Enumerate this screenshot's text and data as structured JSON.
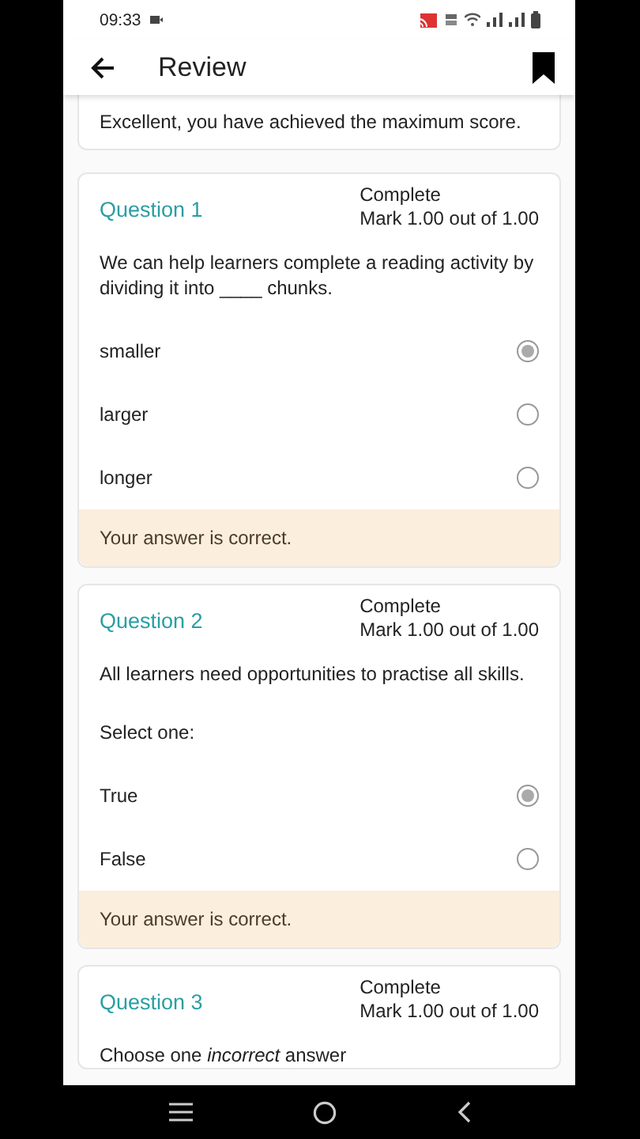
{
  "status_bar": {
    "time": "09:33"
  },
  "app_bar": {
    "title": "Review"
  },
  "feedback": {
    "text": "Excellent, you have achieved the maximum score."
  },
  "questions": [
    {
      "title": "Question 1",
      "state": "Complete",
      "mark": "Mark 1.00 out of 1.00",
      "text": "We can help learners complete a reading activity by dividing it into ____ chunks.",
      "options": [
        {
          "label": "smaller",
          "selected": true
        },
        {
          "label": "larger",
          "selected": false
        },
        {
          "label": "longer",
          "selected": false
        }
      ],
      "result": "Your answer is correct."
    },
    {
      "title": "Question 2",
      "state": "Complete",
      "mark": "Mark 1.00 out of 1.00",
      "text": "All learners need opportunities to practise all skills.",
      "prompt": "Select one:",
      "options": [
        {
          "label": "True",
          "selected": true
        },
        {
          "label": "False",
          "selected": false
        }
      ],
      "result": "Your answer is correct."
    },
    {
      "title": "Question 3",
      "state": "Complete",
      "mark": "Mark 1.00 out of 1.00",
      "text": "Choose one *incorrect* answer"
    }
  ]
}
